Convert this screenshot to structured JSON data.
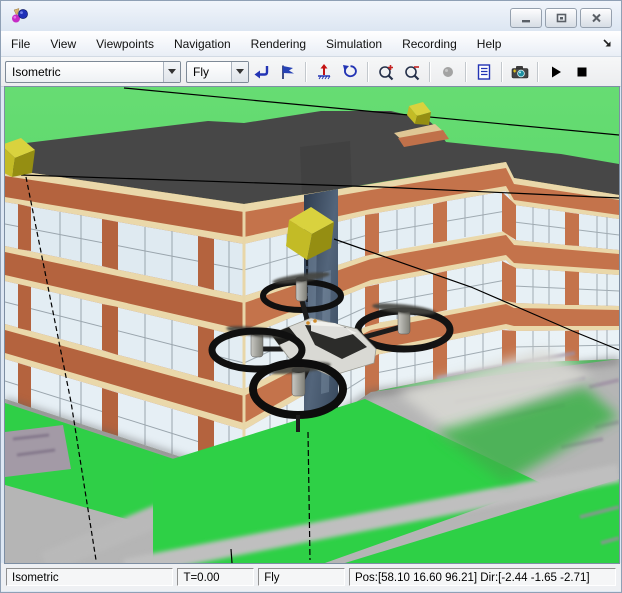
{
  "window": {
    "title": ""
  },
  "menu": {
    "items": [
      {
        "label": "File"
      },
      {
        "label": "View"
      },
      {
        "label": "Viewpoints"
      },
      {
        "label": "Navigation"
      },
      {
        "label": "Rendering"
      },
      {
        "label": "Simulation"
      },
      {
        "label": "Recording"
      },
      {
        "label": "Help"
      }
    ]
  },
  "toolbar": {
    "viewpoint_combo": {
      "value": "Isometric"
    },
    "navigation_combo": {
      "value": "Fly"
    }
  },
  "statusbar": {
    "viewpoint": "Isometric",
    "time": "T=0.00",
    "navigation_mode": "Fly",
    "camera_pose": "Pos:[58.10 16.60 96.21] Dir:[-2.44 -1.65 -2.71]"
  },
  "scene": {
    "objects": [
      "office building",
      "quadcopter drone",
      "yellow waypoint cubes",
      "flight trajectory lines",
      "grass",
      "pavement"
    ],
    "colors": {
      "grass": "#3fd158",
      "roof": "#474747",
      "brick": "#bf6f48",
      "trim": "#ead8aa",
      "glass": "#e6eff5",
      "pavement": "#b5b5b5",
      "waypoint": "#cdc52e",
      "trajectory": "#000000"
    }
  }
}
